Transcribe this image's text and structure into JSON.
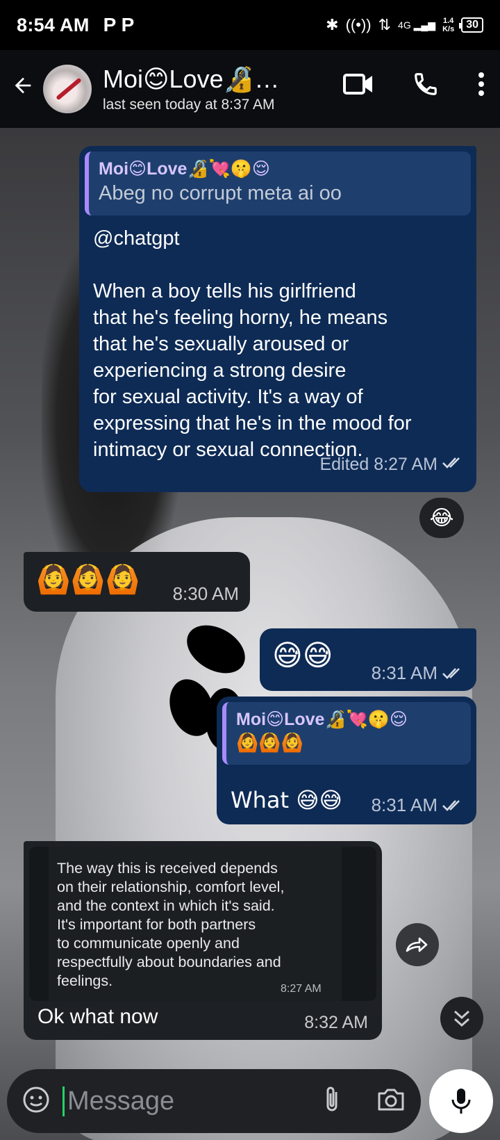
{
  "status_bar": {
    "time": "8:54 AM",
    "notification_letters": "P  P",
    "network_type": "4G",
    "speed_value": "1.4",
    "speed_unit": "K/s",
    "battery": "30"
  },
  "header": {
    "contact_name": "Moi😊Love🔏…",
    "last_seen": "last seen today at 8:37 AM"
  },
  "messages": [
    {
      "quote_name": "Moi😊Love🔏💘🤫😌",
      "quote_text": "Abeg no corrupt meta ai oo",
      "text": "@chatgpt\n\nWhen a boy tells his girlfriend\nthat he's feeling horny, he means\nthat he's sexually aroused or\nexperiencing a strong desire\nfor sexual activity. It's a way of\nexpressing that he's in the mood for\nintimacy or sexual connection.",
      "meta": "Edited 8:27 AM",
      "reaction": "😂"
    },
    {
      "text": "🙆🙆🙆",
      "meta": "8:30 AM"
    },
    {
      "text": "😅😅",
      "meta": "8:31 AM"
    },
    {
      "quote_name": "Moi😊Love🔏💘🤫😌",
      "quote_text": "🙆🙆🙆",
      "text": "What 😅😅",
      "meta": "8:31 AM"
    },
    {
      "image_text": "The way this is received depends\non their relationship, comfort level,\nand the context in which it's said.\nIt's important for both partners\nto communicate openly and\nrespectfully about boundaries and\nfeelings.",
      "image_time": "8:27 AM",
      "text": "Ok what now",
      "meta": "8:32 AM"
    }
  ],
  "composer": {
    "placeholder": "Message"
  },
  "colors": {
    "outgoing_bubble": "#0e2b55",
    "incoming_bubble": "#1d2024",
    "quote_accent": "#a78bfa"
  },
  "icons": [
    "back-arrow-icon",
    "video-call-icon",
    "phone-icon",
    "more-vert-icon",
    "double-check-icon",
    "forward-icon",
    "scroll-down-icon",
    "sticker-icon",
    "attach-icon",
    "camera-icon",
    "mic-icon"
  ]
}
